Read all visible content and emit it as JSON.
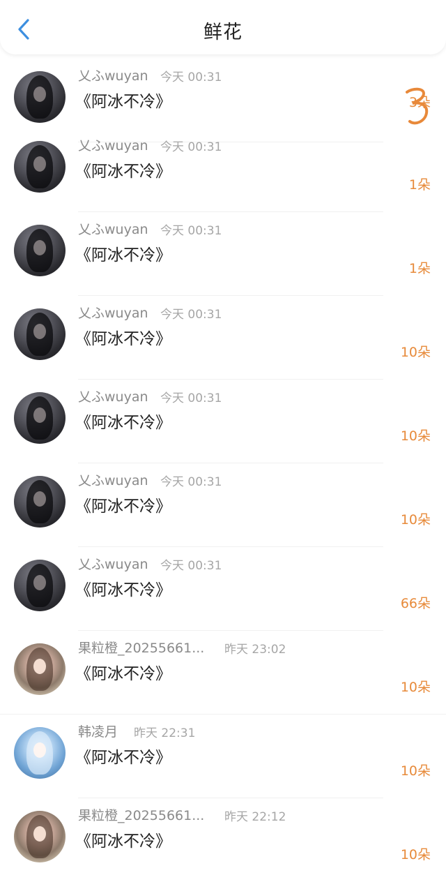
{
  "header": {
    "title": "鲜花",
    "back_icon": "chevron-left-icon",
    "accent_color": "#3d8fe0"
  },
  "records": [
    {
      "user": "乂ふwuyan",
      "time": "今天 00:31",
      "book": "《阿冰不冷》",
      "amount": "3朵",
      "avatar": "dark",
      "annotated": true
    },
    {
      "user": "乂ふwuyan",
      "time": "今天 00:31",
      "book": "《阿冰不冷》",
      "amount": "1朵",
      "avatar": "dark"
    },
    {
      "user": "乂ふwuyan",
      "time": "今天 00:31",
      "book": "《阿冰不冷》",
      "amount": "1朵",
      "avatar": "dark"
    },
    {
      "user": "乂ふwuyan",
      "time": "今天 00:31",
      "book": "《阿冰不冷》",
      "amount": "10朵",
      "avatar": "dark"
    },
    {
      "user": "乂ふwuyan",
      "time": "今天 00:31",
      "book": "《阿冰不冷》",
      "amount": "10朵",
      "avatar": "dark"
    },
    {
      "user": "乂ふwuyan",
      "time": "今天 00:31",
      "book": "《阿冰不冷》",
      "amount": "10朵",
      "avatar": "dark"
    },
    {
      "user": "乂ふwuyan",
      "time": "今天 00:31",
      "book": "《阿冰不冷》",
      "amount": "66朵",
      "avatar": "dark"
    },
    {
      "user": "果粒橙_20255661...",
      "time": "昨天 23:02",
      "book": "《阿冰不冷》",
      "amount": "10朵",
      "avatar": "doll"
    },
    {
      "user": "韩凌月",
      "time": "昨天 22:31",
      "book": "《阿冰不冷》",
      "amount": "10朵",
      "avatar": "blue"
    },
    {
      "user": "果粒橙_20255661...",
      "time": "昨天 22:12",
      "book": "《阿冰不冷》",
      "amount": "10朵",
      "avatar": "doll"
    }
  ],
  "colors": {
    "amount": "#e78a3a",
    "scribble": "#e8893a"
  }
}
